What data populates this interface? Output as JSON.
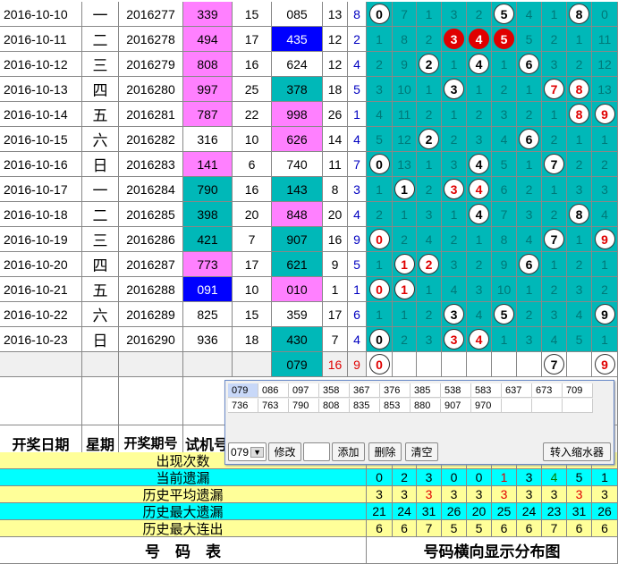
{
  "header": {
    "date": "开奖日期",
    "weekday": "星期",
    "issue": "开奖期号",
    "trial": "试机号"
  },
  "rows": [
    {
      "date": "2016-10-10",
      "wk": "一",
      "issue": "2016277",
      "a": "339",
      "b": "15",
      "c": "085",
      "d": "13",
      "e": "8",
      "dist": [
        "0",
        "7",
        "1",
        "3",
        "2",
        "5",
        "4",
        "1",
        "8",
        "0"
      ]
    },
    {
      "date": "2016-10-11",
      "wk": "二",
      "issue": "2016278",
      "a": "494",
      "b": "17",
      "c": "435",
      "d": "12",
      "e": "2",
      "dist": [
        "1",
        "8",
        "2",
        "3",
        "4",
        "5",
        "5",
        "2",
        "1",
        "11"
      ]
    },
    {
      "date": "2016-10-12",
      "wk": "三",
      "issue": "2016279",
      "a": "808",
      "b": "16",
      "c": "624",
      "d": "12",
      "e": "4",
      "dist": [
        "2",
        "9",
        "2",
        "1",
        "4",
        "1",
        "6",
        "3",
        "2",
        "12"
      ]
    },
    {
      "date": "2016-10-13",
      "wk": "四",
      "issue": "2016280",
      "a": "997",
      "b": "25",
      "c": "378",
      "d": "18",
      "e": "5",
      "dist": [
        "3",
        "10",
        "1",
        "3",
        "1",
        "2",
        "1",
        "7",
        "8",
        "13"
      ]
    },
    {
      "date": "2016-10-14",
      "wk": "五",
      "issue": "2016281",
      "a": "787",
      "b": "22",
      "c": "998",
      "d": "26",
      "e": "1",
      "dist": [
        "4",
        "11",
        "2",
        "1",
        "2",
        "3",
        "2",
        "1",
        "8",
        "9"
      ]
    },
    {
      "date": "2016-10-15",
      "wk": "六",
      "issue": "2016282",
      "a": "316",
      "b": "10",
      "c": "626",
      "d": "14",
      "e": "4",
      "dist": [
        "5",
        "12",
        "2",
        "2",
        "3",
        "4",
        "6",
        "2",
        "1",
        "1"
      ]
    },
    {
      "date": "2016-10-16",
      "wk": "日",
      "issue": "2016283",
      "a": "141",
      "b": "6",
      "c": "740",
      "d": "11",
      "e": "7",
      "dist": [
        "0",
        "13",
        "1",
        "3",
        "4",
        "5",
        "1",
        "7",
        "2",
        "2"
      ]
    },
    {
      "date": "2016-10-17",
      "wk": "一",
      "issue": "2016284",
      "a": "790",
      "b": "16",
      "c": "143",
      "d": "8",
      "e": "3",
      "dist": [
        "1",
        "1",
        "2",
        "3",
        "4",
        "6",
        "2",
        "1",
        "3",
        "3"
      ]
    },
    {
      "date": "2016-10-18",
      "wk": "二",
      "issue": "2016285",
      "a": "398",
      "b": "20",
      "c": "848",
      "d": "20",
      "e": "4",
      "dist": [
        "2",
        "1",
        "3",
        "1",
        "4",
        "7",
        "3",
        "2",
        "8",
        "4"
      ]
    },
    {
      "date": "2016-10-19",
      "wk": "三",
      "issue": "2016286",
      "a": "421",
      "b": "7",
      "c": "907",
      "d": "16",
      "e": "9",
      "dist": [
        "0",
        "2",
        "4",
        "2",
        "1",
        "8",
        "4",
        "7",
        "1",
        "9"
      ]
    },
    {
      "date": "2016-10-20",
      "wk": "四",
      "issue": "2016287",
      "a": "773",
      "b": "17",
      "c": "621",
      "d": "9",
      "e": "5",
      "dist": [
        "1",
        "1",
        "2",
        "3",
        "2",
        "9",
        "6",
        "1",
        "2",
        "1"
      ]
    },
    {
      "date": "2016-10-21",
      "wk": "五",
      "issue": "2016288",
      "a": "091",
      "b": "10",
      "c": "010",
      "d": "1",
      "e": "1",
      "dist": [
        "0",
        "1",
        "1",
        "4",
        "3",
        "10",
        "1",
        "2",
        "3",
        "2"
      ]
    },
    {
      "date": "2016-10-22",
      "wk": "六",
      "issue": "2016289",
      "a": "825",
      "b": "15",
      "c": "359",
      "d": "17",
      "e": "6",
      "dist": [
        "1",
        "1",
        "2",
        "3",
        "4",
        "5",
        "2",
        "3",
        "4",
        "9"
      ]
    },
    {
      "date": "2016-10-23",
      "wk": "日",
      "issue": "2016290",
      "a": "936",
      "b": "18",
      "c": "430",
      "d": "7",
      "e": "4",
      "dist": [
        "0",
        "2",
        "3",
        "3",
        "4",
        "1",
        "3",
        "4",
        "5",
        "1"
      ]
    }
  ],
  "extra_row": {
    "c": "079",
    "d": "16",
    "e": "9",
    "dist": [
      "0",
      "",
      "",
      "",
      "",
      "",
      "",
      "7",
      "",
      "9"
    ]
  },
  "stats": [
    {
      "label": "出现次数",
      "vals": []
    },
    {
      "label": "当前遗漏",
      "vals": [
        "0",
        "2",
        "3",
        "0",
        "0",
        "1",
        "3",
        "4",
        "5",
        "1"
      ]
    },
    {
      "label": "历史平均遗漏",
      "vals": [
        "3",
        "3",
        "3",
        "3",
        "3",
        "3",
        "3",
        "3",
        "3",
        "3"
      ]
    },
    {
      "label": "历史最大遗漏",
      "vals": [
        "21",
        "24",
        "31",
        "26",
        "20",
        "25",
        "24",
        "23",
        "31",
        "26"
      ]
    },
    {
      "label": "历史最大连出",
      "vals": [
        "6",
        "6",
        "7",
        "5",
        "5",
        "6",
        "6",
        "7",
        "6",
        "6"
      ]
    }
  ],
  "footer": {
    "left": "号　码　表",
    "right": "号码横向显示分布图"
  },
  "popup": {
    "codes": [
      "079",
      "086",
      "097",
      "358",
      "367",
      "376",
      "385",
      "538",
      "583",
      "637",
      "673",
      "709",
      "736",
      "763",
      "790",
      "808",
      "835",
      "853",
      "880",
      "907",
      "970"
    ],
    "select_value": "079",
    "modify_label": "修改",
    "add_label": "添加",
    "delete_label": "删除",
    "clear_label": "清空",
    "transfer_label": "转入缩水器"
  }
}
